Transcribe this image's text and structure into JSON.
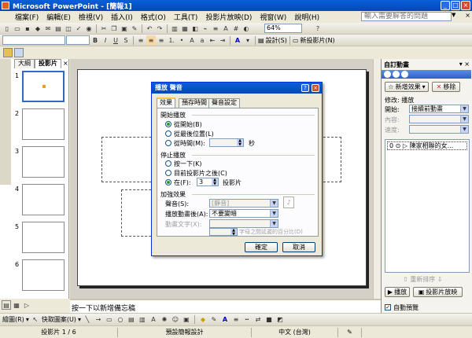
{
  "window": {
    "title": "Microsoft PowerPoint - [簡報1]"
  },
  "menubar": {
    "items": [
      "檔案(F)",
      "編輯(E)",
      "檢視(V)",
      "插入(I)",
      "格式(O)",
      "工具(T)",
      "投影片放映(D)",
      "視窗(W)",
      "說明(H)"
    ],
    "help_placeholder": "輸入需要解答的問題"
  },
  "toolbar": {
    "zoom": "64%",
    "design_label": "設計(S)",
    "new_slide_label": "新投影片(N)"
  },
  "left_pane": {
    "tabs": [
      "大綱",
      "投影片"
    ],
    "slide_numbers": [
      "1",
      "2",
      "3",
      "4",
      "5",
      "6"
    ]
  },
  "notes": {
    "placeholder": "按一下以新增備忘稿"
  },
  "task_pane": {
    "title": "自訂動畫",
    "add_effect_label": "新增效果",
    "remove_label": "移除",
    "modify_label": "修改: 播放",
    "start_label": "開始:",
    "start_value": "接續前動畫",
    "property_label": "內容:",
    "speed_label": "速度:",
    "list_item": "0 ⊙ ▷ 陳家相聯的女...",
    "reorder_label": "重新排序",
    "play_label": "播放",
    "slideshow_label": "投影片放映",
    "autopreview_label": "自動預覽"
  },
  "dialog": {
    "title": "播放 聲音",
    "tabs": [
      "效果",
      "預存時間",
      "聲音設定"
    ],
    "start_group": "開始播放",
    "start_options": [
      "從開始(B)",
      "從最後位置(L)",
      "從時間(M):"
    ],
    "seconds_label": "秒",
    "stop_group": "停止播放",
    "stop_options": [
      "按一下(K)",
      "目前投影片之後(C)",
      "在(F):"
    ],
    "stop_after_value": "3",
    "slides_label": "投影片",
    "enhance_group": "加強效果",
    "sound_label": "聲音(S):",
    "sound_value": "[靜音]",
    "after_anim_label": "播放動畫後(A):",
    "after_anim_value": "不要變暗",
    "animate_text_label": "動畫文字(X):",
    "delay_label": "字母之間延遲的百分比(D)",
    "ok_label": "確定",
    "cancel_label": "取消"
  },
  "drawing_toolbar": {
    "draw_label": "繪圖(R)",
    "autoshapes_label": "快取圖案(U)"
  },
  "statusbar": {
    "slide_info": "投影片 1 / 6",
    "design": "預設簡報設計",
    "language": "中文 (台灣)"
  }
}
